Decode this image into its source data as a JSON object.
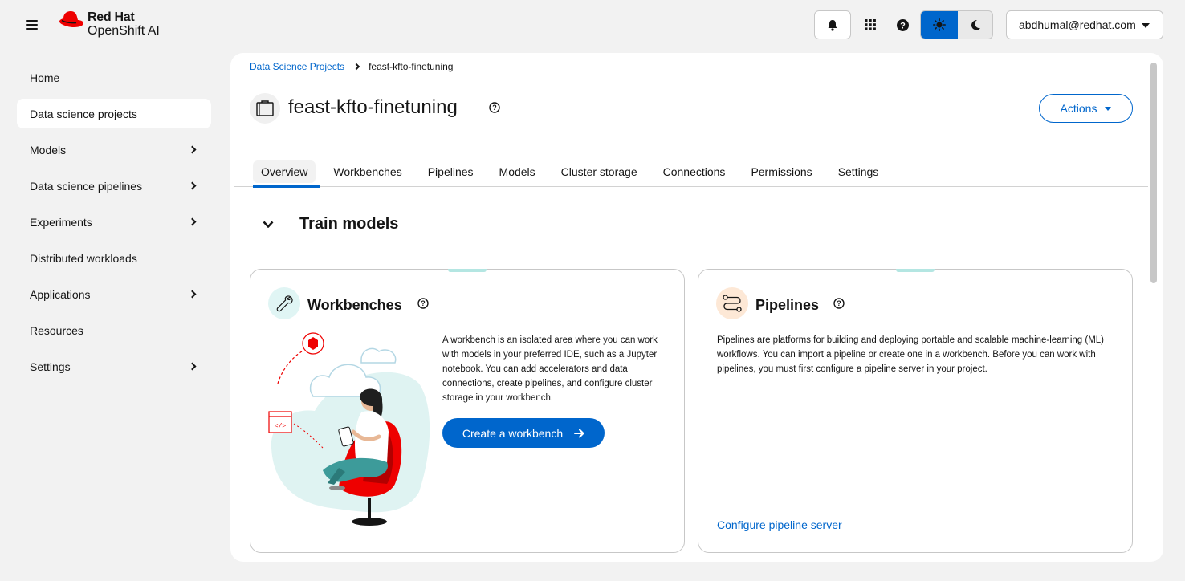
{
  "header": {
    "brand_line1": "Red Hat",
    "brand_line2": "OpenShift AI",
    "user": "abdhumal@redhat.com"
  },
  "sidebar": {
    "items": [
      {
        "label": "Home"
      },
      {
        "label": "Data science projects"
      },
      {
        "label": "Models"
      },
      {
        "label": "Data science pipelines"
      },
      {
        "label": "Experiments"
      },
      {
        "label": "Distributed workloads"
      },
      {
        "label": "Applications"
      },
      {
        "label": "Resources"
      },
      {
        "label": "Settings"
      }
    ]
  },
  "breadcrumb": {
    "parent": "Data Science Projects",
    "current": "feast-kfto-finetuning"
  },
  "project": {
    "title": "feast-kfto-finetuning",
    "actions_label": "Actions"
  },
  "tabs": [
    {
      "label": "Overview"
    },
    {
      "label": "Workbenches"
    },
    {
      "label": "Pipelines"
    },
    {
      "label": "Models"
    },
    {
      "label": "Cluster storage"
    },
    {
      "label": "Connections"
    },
    {
      "label": "Permissions"
    },
    {
      "label": "Settings"
    }
  ],
  "section": {
    "title": "Train models"
  },
  "cards": {
    "workbenches": {
      "title": "Workbenches",
      "description": "A workbench is an isolated area where you can work with models in your preferred IDE, such as a Jupyter notebook. You can add accelerators and data connections, create pipelines, and configure cluster storage in your workbench.",
      "button": "Create a workbench"
    },
    "pipelines": {
      "title": "Pipelines",
      "description": "Pipelines are platforms for building and deploying portable and scalable machine-learning (ML) workflows. You can import a pipeline or create one in a workbench. Before you can work with pipelines, you must first configure a pipeline server in your project.",
      "link": "Configure pipeline server"
    }
  },
  "colors": {
    "accent": "#0066cc",
    "brand_red": "#ee0000",
    "card_accent": "#b4e6e2"
  }
}
